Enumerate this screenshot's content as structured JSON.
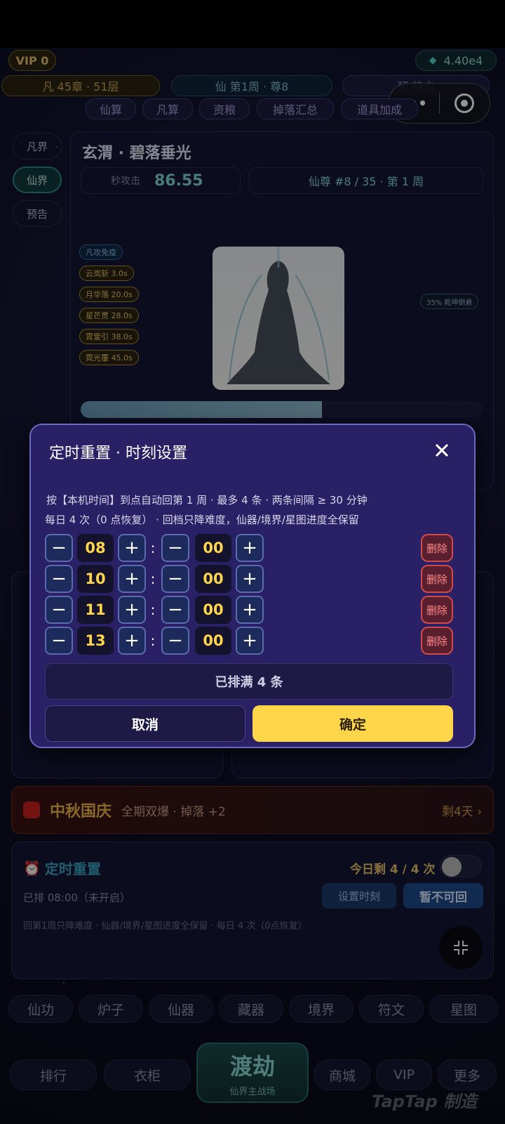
{
  "header": {
    "vip": "VIP 0",
    "currency": "4.40e4",
    "mortal_progress": "凡 45章 · 51层",
    "immortal_progress": "仙 第1周 · 尊8",
    "pending": "预 待启"
  },
  "top_tabs": [
    "仙算",
    "凡算",
    "资粮",
    "掉落汇总",
    "道具加成"
  ],
  "side_nav": [
    "凡界",
    "仙界",
    "预告"
  ],
  "boss": {
    "name": "玄渭 · 碧落垂光",
    "dps_label": "秒攻击",
    "dps_value": "86.55",
    "rank": "仙尊 #8 / 35 · 第 1 周",
    "immune": "凡攻免疫",
    "skills": [
      "云岚斩 3.0s",
      "月华落 20.0s",
      "星芒贯 28.0s",
      "霄雷引 38.0s",
      "霓光覆 45.0s"
    ],
    "buff": "35% 乾坤倒悬",
    "hp_fraction": 0.6
  },
  "event": {
    "title": "中秋国庆",
    "desc": "全期双爆 · 掉落 +2",
    "remain": "剩4天 ›"
  },
  "timer_card": {
    "title": "定时重置",
    "today": "今日剩 4 / 4 次",
    "scheduled": "已排 08:00（未开启）",
    "set_btn": "设置时刻",
    "disabled_btn": "暂不可回",
    "note": "回第1周只降难度 · 仙器/境界/星图进度全保留 · 每日 4 次（0点恢复）"
  },
  "bottom_tabs": [
    "仙功",
    "炉子",
    "仙器",
    "藏器",
    "境界",
    "符文",
    "星图"
  ],
  "bottom_nav": {
    "rank": "排行",
    "wardrobe": "衣柜",
    "main": "渡劫",
    "main_sub": "仙界主战场",
    "shop": "商城",
    "vip": "VIP",
    "more": "更多",
    "watermark": "TapTap 制造"
  },
  "modal": {
    "title": "定时重置 · 时刻设置",
    "desc1": "按【本机时间】到点自动回第 1 周 · 最多 4 条 · 两条间隔 ≥ 30 分钟",
    "desc2": "每日 4 次（0 点恢复） · 回档只降难度，仙器/境界/星图进度全保留",
    "minus": "−",
    "plus": "+",
    "colon": ":",
    "delete": "删除",
    "rows": [
      {
        "hour": "08",
        "minute": "00"
      },
      {
        "hour": "10",
        "minute": "00"
      },
      {
        "hour": "11",
        "minute": "00"
      },
      {
        "hour": "13",
        "minute": "00"
      }
    ],
    "full_label": "已排满 4 条",
    "cancel": "取消",
    "confirm": "确定"
  },
  "capsule": {
    "more_icon": "•••"
  },
  "colors": {
    "accent": "#ffd54a",
    "modal_bg": "#2a2065",
    "delete": "#d04a4a"
  }
}
